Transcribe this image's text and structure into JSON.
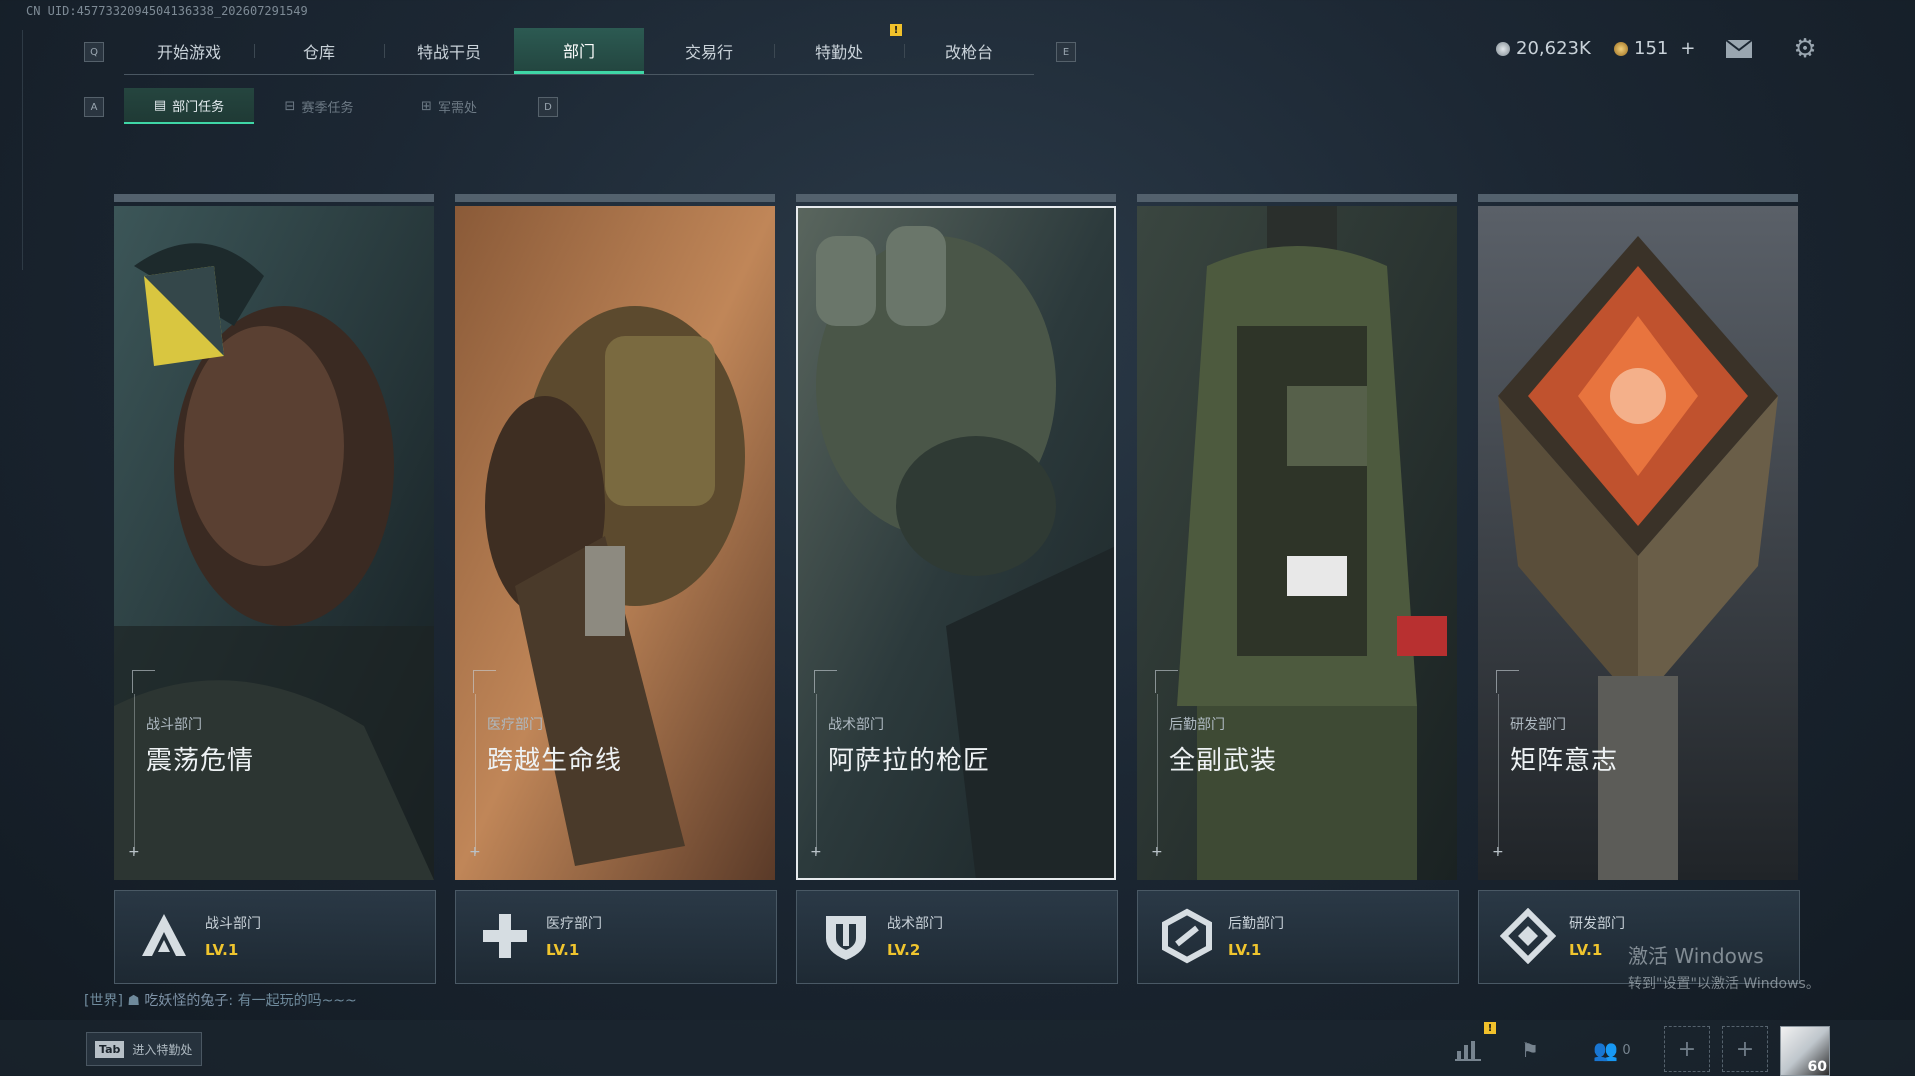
{
  "uid_text": "CN UID:4577332094504136338_202607291549",
  "hotkeys": {
    "prev_tab": "Q",
    "next_tab": "E",
    "prev_sub": "A",
    "next_sub": "D"
  },
  "nav": {
    "tabs": [
      {
        "label": "开始游戏"
      },
      {
        "label": "仓库"
      },
      {
        "label": "特战干员"
      },
      {
        "label": "部门",
        "active": true
      },
      {
        "label": "交易行"
      },
      {
        "label": "特勤处"
      },
      {
        "label": "改枪台"
      }
    ],
    "warning_badge": "!"
  },
  "subnav": {
    "tabs": [
      {
        "label": "部门任务",
        "icon": "task-icon",
        "active": true
      },
      {
        "label": "赛季任务",
        "icon": "season-icon"
      },
      {
        "label": "军需处",
        "icon": "supply-icon"
      }
    ]
  },
  "currency": {
    "main": "20,623K",
    "secondary": "151",
    "add": "+",
    "main_color": "#b9c2c8",
    "secondary_color": "#d8a848"
  },
  "cards": [
    {
      "dept": "战斗部门",
      "title": "震荡危情",
      "level": "LV.1",
      "emblem": "combat-emblem-icon"
    },
    {
      "dept": "医疗部门",
      "title": "跨越生命线",
      "level": "LV.1",
      "emblem": "medical-emblem-icon"
    },
    {
      "dept": "战术部门",
      "title": "阿萨拉的枪匠",
      "level": "LV.2",
      "emblem": "tactical-emblem-icon",
      "selected": true
    },
    {
      "dept": "后勤部门",
      "title": "全副武装",
      "level": "LV.1",
      "emblem": "logistics-emblem-icon"
    },
    {
      "dept": "研发部门",
      "title": "矩阵意志",
      "level": "LV.1",
      "emblem": "research-emblem-icon"
    }
  ],
  "chat": {
    "channel": "[世界]",
    "sender": "吃妖怪的兔子",
    "message": "有一起玩的吗~~~"
  },
  "bottom": {
    "tab_key": "Tab",
    "tab_hint": "进入特勤处",
    "friends_count": "0",
    "level": "60",
    "alert": "!"
  },
  "watermark": {
    "line1": "激活 Windows",
    "line2": "转到\"设置\"以激活 Windows。"
  },
  "accent_color": "#3fd6a6",
  "level_color": "#f0c52e"
}
